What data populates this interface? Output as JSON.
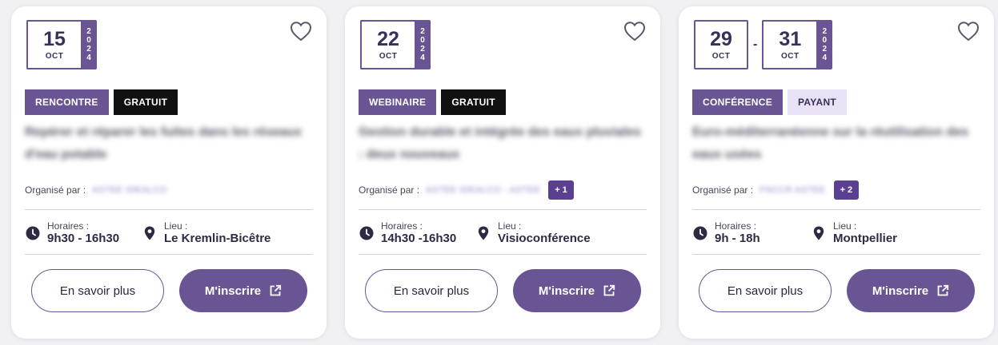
{
  "cards": [
    {
      "dates": [
        {
          "day": "15",
          "month": "OCT"
        }
      ],
      "year_digits": [
        "2",
        "0",
        "2",
        "4"
      ],
      "category": "RENCONTRE",
      "price": "GRATUIT",
      "title": "Repérer et réparer les fuites dans les réseaux d'eau potable",
      "organizer_label": "Organisé par :",
      "organizer_names": "ASTEE IDEALCO",
      "hours_label": "Horaires :",
      "hours_value": "9h30 - 16h30",
      "place_label": "Lieu :",
      "place_value": "Le Kremlin-Bicêtre",
      "more_label": "En savoir plus",
      "register_label": "M'inscrire"
    },
    {
      "dates": [
        {
          "day": "22",
          "month": "OCT"
        }
      ],
      "year_digits": [
        "2",
        "0",
        "2",
        "4"
      ],
      "category": "WEBINAIRE",
      "price": "GRATUIT",
      "title": "Gestion durable et intégrée des eaux pluviales : deux nouveaux",
      "organizer_label": "Organisé par :",
      "organizer_names": "ASTEE IDEALCO - ASTEE",
      "extra_organizers": "+ 1",
      "hours_label": "Horaires :",
      "hours_value": "14h30 -16h30",
      "place_label": "Lieu :",
      "place_value": "Visioconférence",
      "more_label": "En savoir plus",
      "register_label": "M'inscrire"
    },
    {
      "dates": [
        {
          "day": "29",
          "month": "OCT"
        },
        {
          "day": "31",
          "month": "OCT"
        }
      ],
      "date_separator": "-",
      "year_digits": [
        "2",
        "0",
        "2",
        "4"
      ],
      "category": "CONFÉRENCE",
      "price": "PAYANT",
      "title": "Euro-méditerranéenne sur la réutilisation des eaux usées",
      "organizer_label": "Organisé par :",
      "organizer_names": "FNCCR ASTEE",
      "extra_organizers": "+ 2",
      "hours_label": "Horaires :",
      "hours_value": "9h - 18h",
      "place_label": "Lieu :",
      "place_value": "Montpellier",
      "more_label": "En savoir plus",
      "register_label": "M'inscrire"
    }
  ],
  "colors": {
    "accent": "#6a5594",
    "badge_plus": "#5b3f91",
    "free_tag": "#111111",
    "paid_tag": "#e9e1f6"
  },
  "icons": {
    "favorite": "heart-outline-icon",
    "hours": "clock-icon",
    "place": "map-pin-icon",
    "register": "external-link-icon"
  }
}
